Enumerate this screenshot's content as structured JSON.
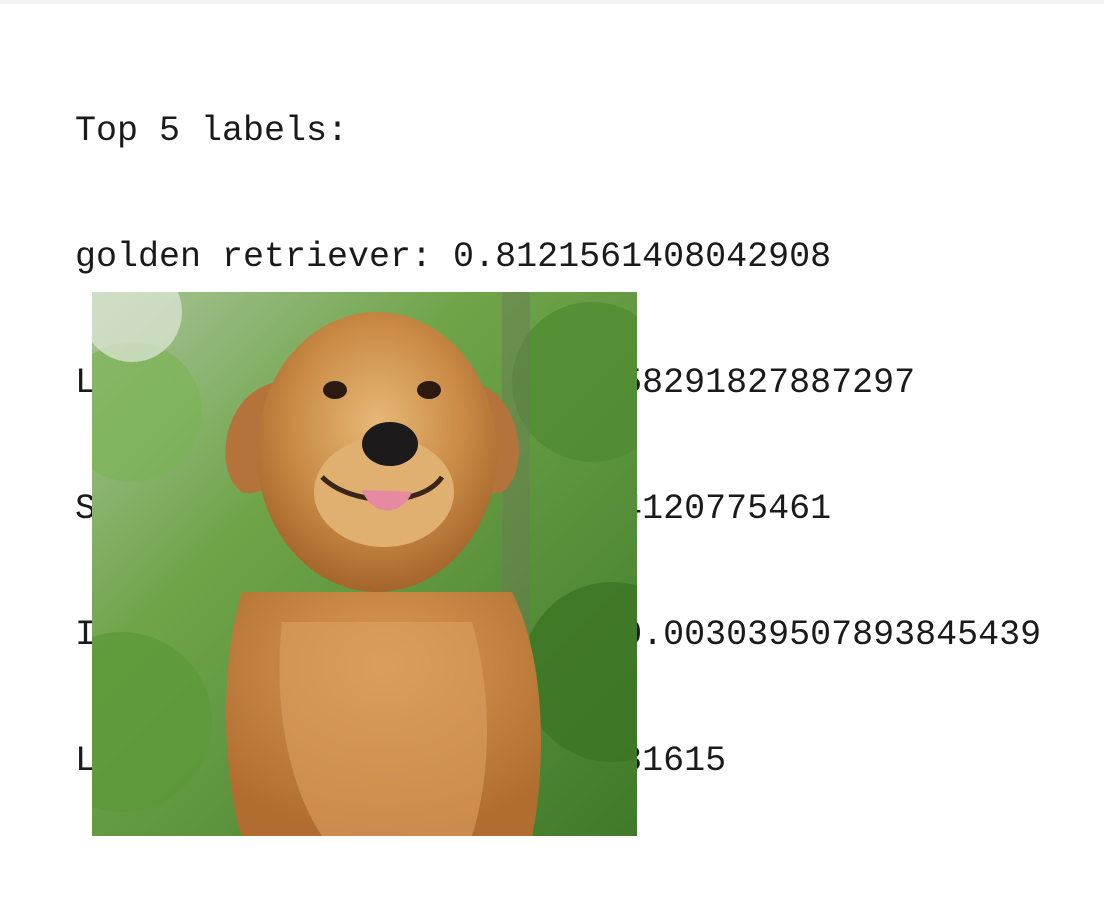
{
  "output": {
    "header": "Top 5 labels:",
    "predictions": [
      {
        "label": "golden retriever",
        "score": "0.8121561408042908"
      },
      {
        "label": "Labrador retriever",
        "score": "0.0061582918278872 97"
      },
      {
        "label": "Sussex spaniel",
        "score": "0.005707214120775461"
      },
      {
        "label": "Irish setter, red setter",
        "score": "0.003039507893845439"
      },
      {
        "label": "Leonberg",
        "score": "0.002916020574048161 5"
      }
    ],
    "lines": [
      "Top 5 labels:",
      "golden retriever: 0.8121561408042908",
      "Labrador retriever: 0.006158291827887297",
      "Sussex spaniel: 0.005707214120775461",
      "Irish setter, red setter: 0.003039507893845439",
      "Leonberg: 0.0029160205740481615"
    ]
  },
  "image": {
    "subject": "golden retriever photo",
    "colors": {
      "background_green": "#5f9a3c",
      "fur": "#c98a45",
      "fur_light": "#e0b070",
      "nose": "#1c1a1a",
      "tongue": "#e58aa0"
    }
  }
}
